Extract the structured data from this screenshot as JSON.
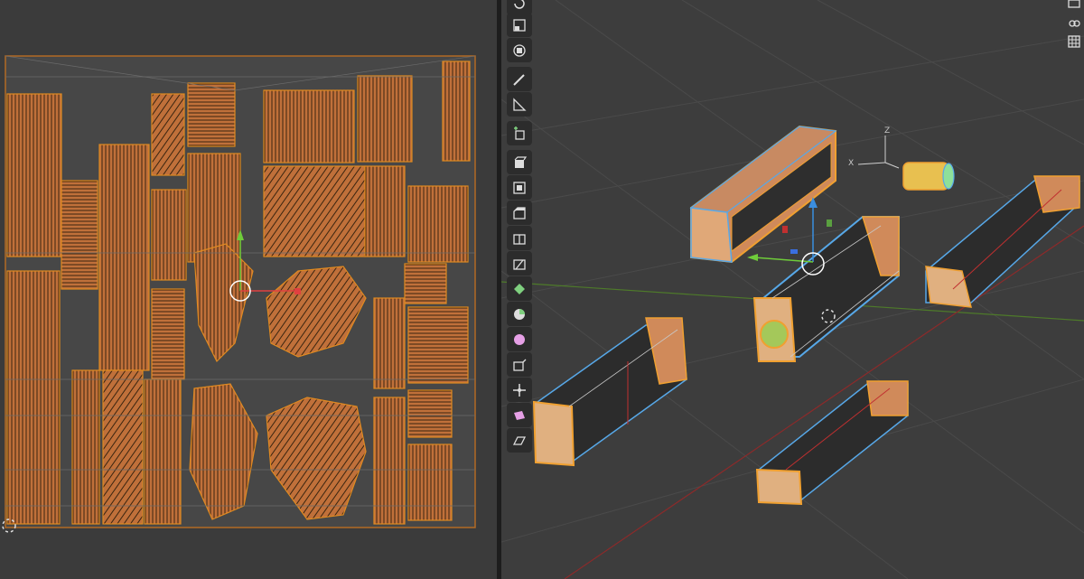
{
  "uv_editor": {
    "background": "#3b3b3b",
    "island_fill": "#c0703a",
    "island_edge": "#e08a20",
    "gizmo_arrow_y": "green",
    "gizmo_arrow_x": "red"
  },
  "viewport": {
    "background": "#3d3d3d",
    "grid_color": "#4a4a4a",
    "x_axis_color": "#8c2a2a",
    "y_axis_color": "#4e7a2a",
    "selection_outline": "#f0a030",
    "active_outline": "#57a8e8",
    "mini_axes": {
      "z_label": "Z",
      "x_label": "X"
    }
  },
  "toolbar": {
    "tools": [
      {
        "name": "rotate-icon",
        "active": false
      },
      {
        "name": "scale-icon",
        "active": false
      },
      {
        "name": "transform-icon",
        "active": false
      },
      {
        "name": "annotate-icon",
        "active": false
      },
      {
        "name": "measure-icon",
        "active": false
      },
      {
        "name": "add-cube-icon",
        "active": false
      },
      {
        "name": "extrude-icon",
        "active": false
      },
      {
        "name": "inset-icon",
        "active": false
      },
      {
        "name": "bevel-icon",
        "active": false
      },
      {
        "name": "loop-cut-icon",
        "active": false
      },
      {
        "name": "knife-icon",
        "active": false
      },
      {
        "name": "poly-build-icon",
        "active": false
      },
      {
        "name": "spin-icon",
        "active": false
      },
      {
        "name": "smooth-icon",
        "active": false
      },
      {
        "name": "edge-slide-icon",
        "active": false
      },
      {
        "name": "shrink-fatten-icon",
        "active": false
      },
      {
        "name": "shear-icon",
        "active": false
      },
      {
        "name": "rip-icon",
        "active": false
      }
    ]
  },
  "right_header": {
    "icons": [
      "camera-icon",
      "hand-icon",
      "grid-view-icon"
    ]
  }
}
